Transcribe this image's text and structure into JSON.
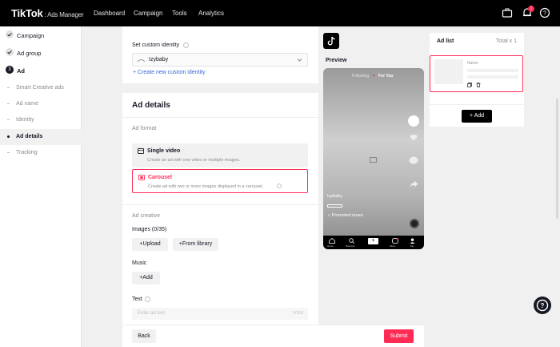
{
  "topbar": {
    "logo": "TikTok",
    "logo_sub": ": Ads Manager",
    "nav": [
      "Dashboard",
      "Campaign",
      "Tools",
      "Analytics"
    ],
    "notification_count": "1"
  },
  "sidebar": {
    "steps": [
      {
        "label": "Campaign",
        "state": "done"
      },
      {
        "label": "Ad group",
        "state": "done"
      },
      {
        "label": "Ad",
        "state": "current",
        "number": "3"
      }
    ],
    "sub_items": [
      "Smart Creative ads",
      "Ad name",
      "Identity",
      "Ad details",
      "Tracking"
    ],
    "active_sub": "Ad details"
  },
  "identity": {
    "label": "Set custom identity",
    "selected": "Izybaby",
    "create_link": "+ Create new custom identity"
  },
  "ad_details": {
    "title": "Ad details",
    "format_label": "Ad format",
    "formats": [
      {
        "title": "Single video",
        "desc": "Create an ad with one video or multiple images."
      },
      {
        "title": "Carousel",
        "desc": "Create ad with two or more images displayed in a carousel."
      }
    ],
    "creative_label": "Ad creative",
    "images_label": "Images (0/35)",
    "upload_btn": "+Upload",
    "library_btn": "+From library",
    "music_label": "Music",
    "music_add_btn": "+Add",
    "text_label": "Text",
    "text_placeholder": "Enter ad text",
    "text_counter": "0/100"
  },
  "footer": {
    "back": "Back",
    "submit": "Submit"
  },
  "preview": {
    "label": "Preview",
    "tabs": [
      "Following",
      "For You"
    ],
    "account": "Izybaby",
    "promoted_music": "♫ Promoted music",
    "nav_items": [
      "Home",
      "Discover",
      "+",
      "Inbox",
      "Me"
    ]
  },
  "ad_list": {
    "title": "Ad list",
    "total": "Total x 1",
    "item_name_label": "Name",
    "add_btn": "+ Add"
  },
  "colors": {
    "accent": "#fe2c55",
    "link": "#3a64d8",
    "dark": "#161823"
  }
}
